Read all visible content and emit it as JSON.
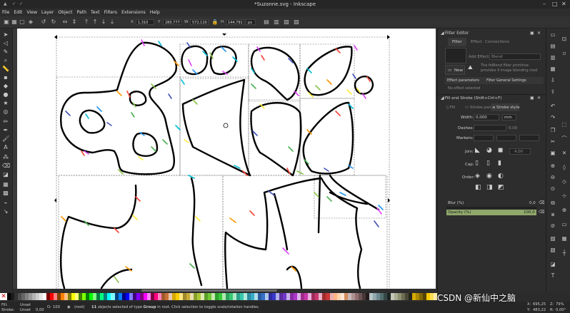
{
  "window": {
    "title": "*Suzanne.svg - Inkscape",
    "minimize": "–",
    "maximize": "□",
    "close": "✕"
  },
  "menu": [
    "File",
    "Edit",
    "View",
    "Layer",
    "Object",
    "Path",
    "Text",
    "Filters",
    "Extensions",
    "Help"
  ],
  "toolbar": {
    "x_label": "X",
    "x_value": "1,310",
    "y_label": "Y",
    "y_value": "280,777",
    "w_label": "W",
    "w_value": "572,110",
    "h_label": "H",
    "h_value": "144,791",
    "unit": "px"
  },
  "filter_editor": {
    "header": "Filter Editor",
    "tabs": [
      "Filter",
      "Effect",
      "Connections"
    ],
    "add_effect_label": "Add Effect:",
    "add_effect_value": "Blend",
    "new_button": "New",
    "hint_line1": "The feBlend filter primitive",
    "hint_line2": "provides 4 image blending mod",
    "subtabs": [
      "Effect parameters",
      "Filter General Settings"
    ],
    "no_effect": "No effect selected"
  },
  "fill_stroke": {
    "header": "Fill and Stroke (Shift+Ctrl+F)",
    "tabs": [
      "Fill",
      "Stroke paint",
      "Stroke style"
    ],
    "width_label": "Width:",
    "width_value": "0,000",
    "width_unit": "mm",
    "dashes_label": "Dashes:",
    "dashes_value": "0,00",
    "markers_label": "Markers:",
    "join_label": "Join:",
    "join_value": "4,00",
    "cap_label": "Cap:",
    "order_label": "Order:",
    "blur_label": "Blur (%)",
    "blur_value": "0,0",
    "opacity_label": "Opacity (%)",
    "opacity_value": "100,0",
    "opacity_fraction": 1.0
  },
  "status": {
    "fill_label": "Fill:",
    "fill_value": "Unset",
    "stroke_label": "Stroke:",
    "stroke_value": "Unset",
    "stroke_width": "0,00",
    "opacity_short": "O:",
    "opacity_value": "100",
    "layer": "(root)",
    "message_count": "11",
    "message_mid": " objects selected of type ",
    "message_type": "Group",
    "message_rest": " in root. Click selection to toggle scale/rotation handles.",
    "cursor_x_label": "X:",
    "cursor_x": "695,25",
    "cursor_y_label": "Y:",
    "cursor_y": "483,22",
    "zoom_label": "Z:",
    "zoom": "79%",
    "rotate_label": "R:",
    "rotate": "0,00°"
  },
  "watermark": "CSDN @新仙中之脑",
  "colors": {
    "accent_opacity": "#8fa86b",
    "canvas": "#ffffff",
    "dark_bg": "#2d2d2d",
    "selection_dash": "#5a5a5a"
  },
  "icons": [
    "selector-icon",
    "node-icon",
    "tweak-icon",
    "zoom-icon",
    "measure-icon",
    "rect-icon",
    "3dbox-icon",
    "ellipse-icon",
    "star-icon",
    "spiral-icon",
    "pencil-icon",
    "pen-icon",
    "calligraphy-icon",
    "text-icon",
    "spray-icon",
    "eraser-icon",
    "bucket-icon",
    "gradient-icon",
    "mesh-icon",
    "dropper-icon",
    "connector-icon"
  ]
}
